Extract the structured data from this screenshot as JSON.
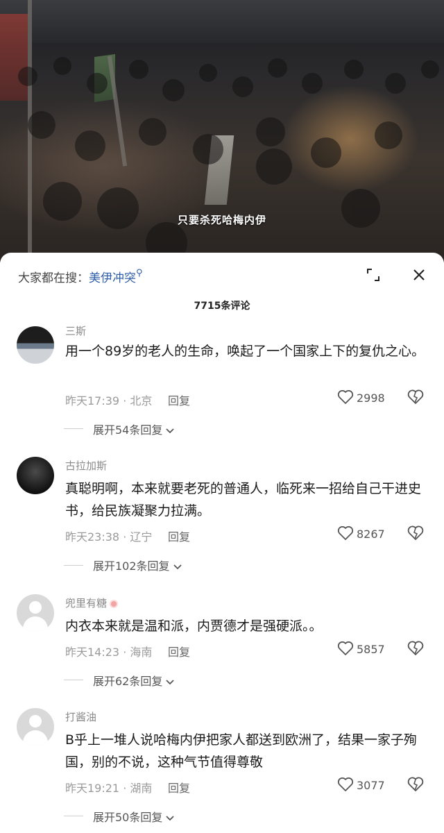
{
  "video": {
    "caption": "只要杀死哈梅内伊"
  },
  "sheet": {
    "search_label": "大家都在搜：",
    "search_keyword": "美伊冲突",
    "comment_count": "7715条评论"
  },
  "comments": [
    {
      "user": "三斯",
      "text": "用一个89岁的老人的生命，唤起了一个国家上下的复仇之心。",
      "time": "昨天17:39 · 北京",
      "reply": "回复",
      "likes": "2998",
      "expand": "展开54条回复"
    },
    {
      "user": "古拉加斯",
      "text": "真聪明啊，本来就要老死的普通人，临死来一招给自己干进史书，给民族凝聚力拉满。",
      "time": "昨天23:38 · 辽宁",
      "reply": "回复",
      "likes": "8267",
      "expand": "展开102条回复"
    },
    {
      "user": "兜里有糖",
      "text": "内衣本来就是温和派，内贾德才是强硬派。。",
      "time": "昨天14:23 · 海南",
      "reply": "回复",
      "likes": "5857",
      "expand": "展开62条回复"
    },
    {
      "user": "打酱油",
      "text": "B乎上一堆人说哈梅内伊把家人都送到欧洲了，结果一家子殉国，别的不说，这种气节值得尊敬",
      "time": "昨天19:21 · 湖南",
      "reply": "回复",
      "likes": "3077",
      "expand": "展开50条回复"
    }
  ]
}
